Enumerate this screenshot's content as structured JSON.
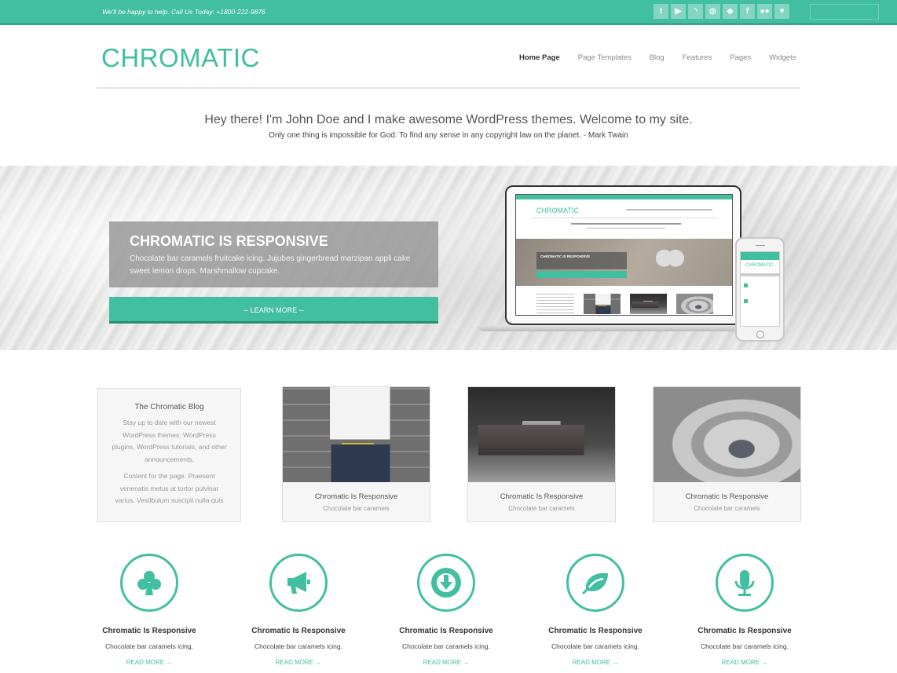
{
  "topbar": {
    "tagline": "We'll be happy to help. Call Us Today: +1800-222-9876",
    "social_icons": [
      {
        "name": "twitter-icon",
        "glyph": "t"
      },
      {
        "name": "youtube-icon",
        "glyph": "▶"
      },
      {
        "name": "rss-icon",
        "glyph": "◝"
      },
      {
        "name": "dribbble-icon",
        "glyph": "◎"
      },
      {
        "name": "dropbox-icon",
        "glyph": "◆"
      },
      {
        "name": "facebook-icon",
        "glyph": "f"
      },
      {
        "name": "flickr-icon",
        "glyph": "●●"
      },
      {
        "name": "foursquare-icon",
        "glyph": "♥"
      }
    ]
  },
  "header": {
    "logo": "CHROMATIC",
    "nav": [
      {
        "label": "Home Page",
        "active": true
      },
      {
        "label": "Page Templates",
        "active": false
      },
      {
        "label": "Blog",
        "active": false
      },
      {
        "label": "Features",
        "active": false
      },
      {
        "label": "Pages",
        "active": false
      },
      {
        "label": "Widgets",
        "active": false
      }
    ]
  },
  "intro": {
    "headline": "Hey there! I'm John Doe and I make awesome WordPress themes. Welcome to my site.",
    "quote": "Only one thing is impossible for God: To find any sense in any copyright law on the planet. - Mark Twain"
  },
  "hero": {
    "title": "CHROMATIC IS RESPONSIVE",
    "text": "Chocolate bar caramels fruitcake icing. Jujubes gingerbread marzipan appli cake sweet lemon drops. Marshmallow cupcake.",
    "button": "-- LEARN MORE --",
    "mockup": {
      "laptop_logo": "CHROMATIC",
      "laptop_box_title": "CHROMATIC IS RESPONSIVE",
      "phone_logo": "CHROMATIC"
    }
  },
  "blog_card": {
    "title": "The Chromatic Blog",
    "para1": "Stay up to date with our newest WordPress themes, WordPress plugins, WordPress tutorials, and other announcements.",
    "para2": "Content for the page. Praesent venenatis metus at tortor pulvinar varius. Vestibulum suscipit nulla quis"
  },
  "cards": [
    {
      "title": "Chromatic Is Responsive",
      "subtitle": "Chocolate bar caramels",
      "image": "man-leaning-on-wall"
    },
    {
      "title": "Chromatic Is Responsive",
      "subtitle": "Chocolate bar caramels",
      "image": "vintage-car"
    },
    {
      "title": "Chromatic Is Responsive",
      "subtitle": "Chocolate bar caramels",
      "image": "stone-archway"
    }
  ],
  "features": [
    {
      "icon": "club-icon",
      "title": "Chromatic Is Responsive",
      "text": "Chocolate bar caramels icing.",
      "link": "READ MORE →"
    },
    {
      "icon": "megaphone-icon",
      "title": "Chromatic Is Responsive",
      "text": "Chocolate bar caramels icing.",
      "link": "READ MORE →"
    },
    {
      "icon": "download-icon",
      "title": "Chromatic Is Responsive",
      "text": "Chocolate bar caramels icing.",
      "link": "READ MORE →"
    },
    {
      "icon": "leaf-icon",
      "title": "Chromatic Is Responsive",
      "text": "Chocolate bar caramels icing.",
      "link": "READ MORE →"
    },
    {
      "icon": "microphone-icon",
      "title": "Chromatic Is Responsive",
      "text": "Chocolate bar caramels icing.",
      "link": "READ MORE →"
    }
  ],
  "colors": {
    "accent": "#41bfa0",
    "accent_dark": "#2a8e75"
  }
}
